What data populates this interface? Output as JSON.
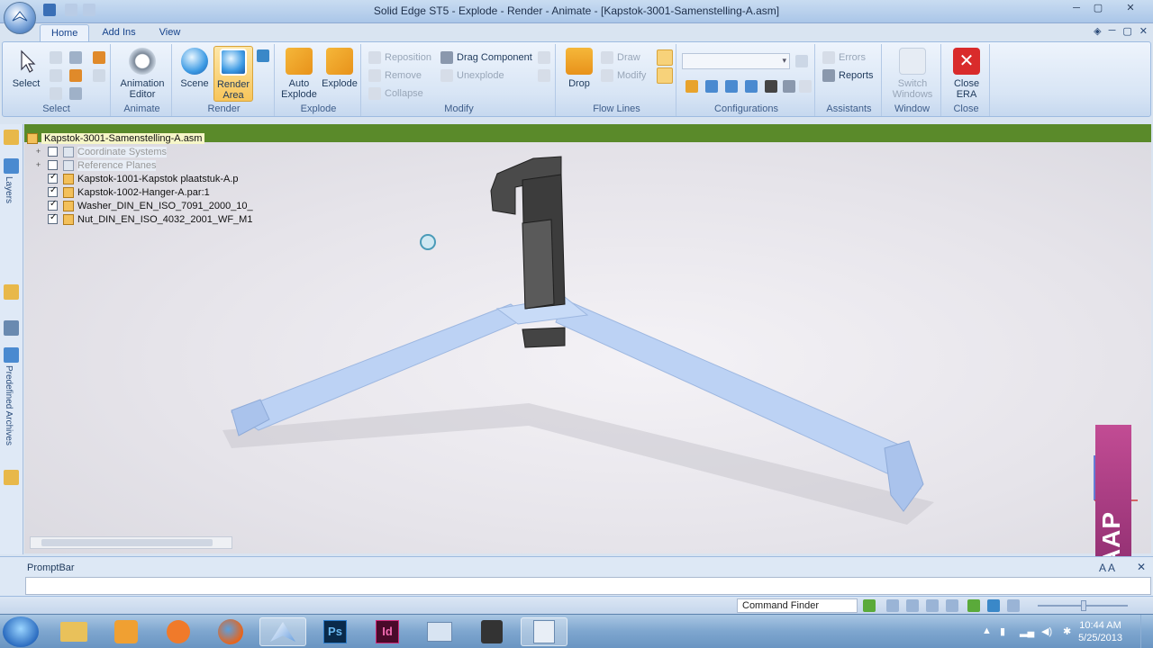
{
  "window": {
    "title": "Solid Edge ST5 - Explode - Render - Animate - [Kapstok-3001-Samenstelling-A.asm]"
  },
  "ribbon": {
    "tabs": [
      "Home",
      "Add Ins",
      "View"
    ],
    "groups": {
      "select": {
        "label": "Select",
        "button": "Select"
      },
      "animate": {
        "label": "Animate",
        "button_line1": "Animation",
        "button_line2": "Editor"
      },
      "render": {
        "label": "Render",
        "scene": "Scene",
        "area_line1": "Render",
        "area_line2": "Area"
      },
      "explode": {
        "label": "Explode",
        "auto_line1": "Auto",
        "auto_line2": "Explode",
        "explode": "Explode"
      },
      "modify": {
        "label": "Modify",
        "reposition": "Reposition",
        "remove": "Remove",
        "collapse": "Collapse",
        "drag_component": "Drag Component",
        "unexplode": "Unexplode"
      },
      "flowlines": {
        "label": "Flow Lines",
        "drop": "Drop",
        "draw": "Draw",
        "modify": "Modify"
      },
      "configurations": {
        "label": "Configurations"
      },
      "assistants": {
        "label": "Assistants",
        "errors": "Errors",
        "reports": "Reports"
      },
      "window": {
        "label": "Window",
        "switch_line1": "Switch",
        "switch_line2": "Windows"
      },
      "close": {
        "label": "Close",
        "close_line1": "Close",
        "close_line2": "ERA"
      }
    }
  },
  "left_tabs": {
    "layers": "Layers",
    "archives": "Predefined Archives"
  },
  "tree": {
    "root": "Kapstok-3001-Samenstelling-A.asm",
    "items": [
      {
        "label": "Coordinate Systems"
      },
      {
        "label": "Reference Planes"
      },
      {
        "label": "Kapstok-1001-Kapstok plaatstuk-A.p"
      },
      {
        "label": "Kapstok-1002-Hanger-A.par:1"
      },
      {
        "label": "Washer_DIN_EN_ISO_7091_2000_10_"
      },
      {
        "label": "Nut_DIN_EN_ISO_4032_2001_WF_M1"
      }
    ]
  },
  "promptbar": {
    "title": "PromptBar"
  },
  "statusbar": {
    "command_finder": "Command Finder"
  },
  "taskbar": {
    "time": "10:44 AM",
    "date": "5/25/2013",
    "ps": "Ps",
    "id": "Id"
  },
  "watermark": {
    "text": "CAAP"
  },
  "colors": {
    "accent": "#5a8a2a",
    "hanger": "#bcd2f4",
    "part": "#3c3c3c",
    "close": "#d92b2b"
  }
}
